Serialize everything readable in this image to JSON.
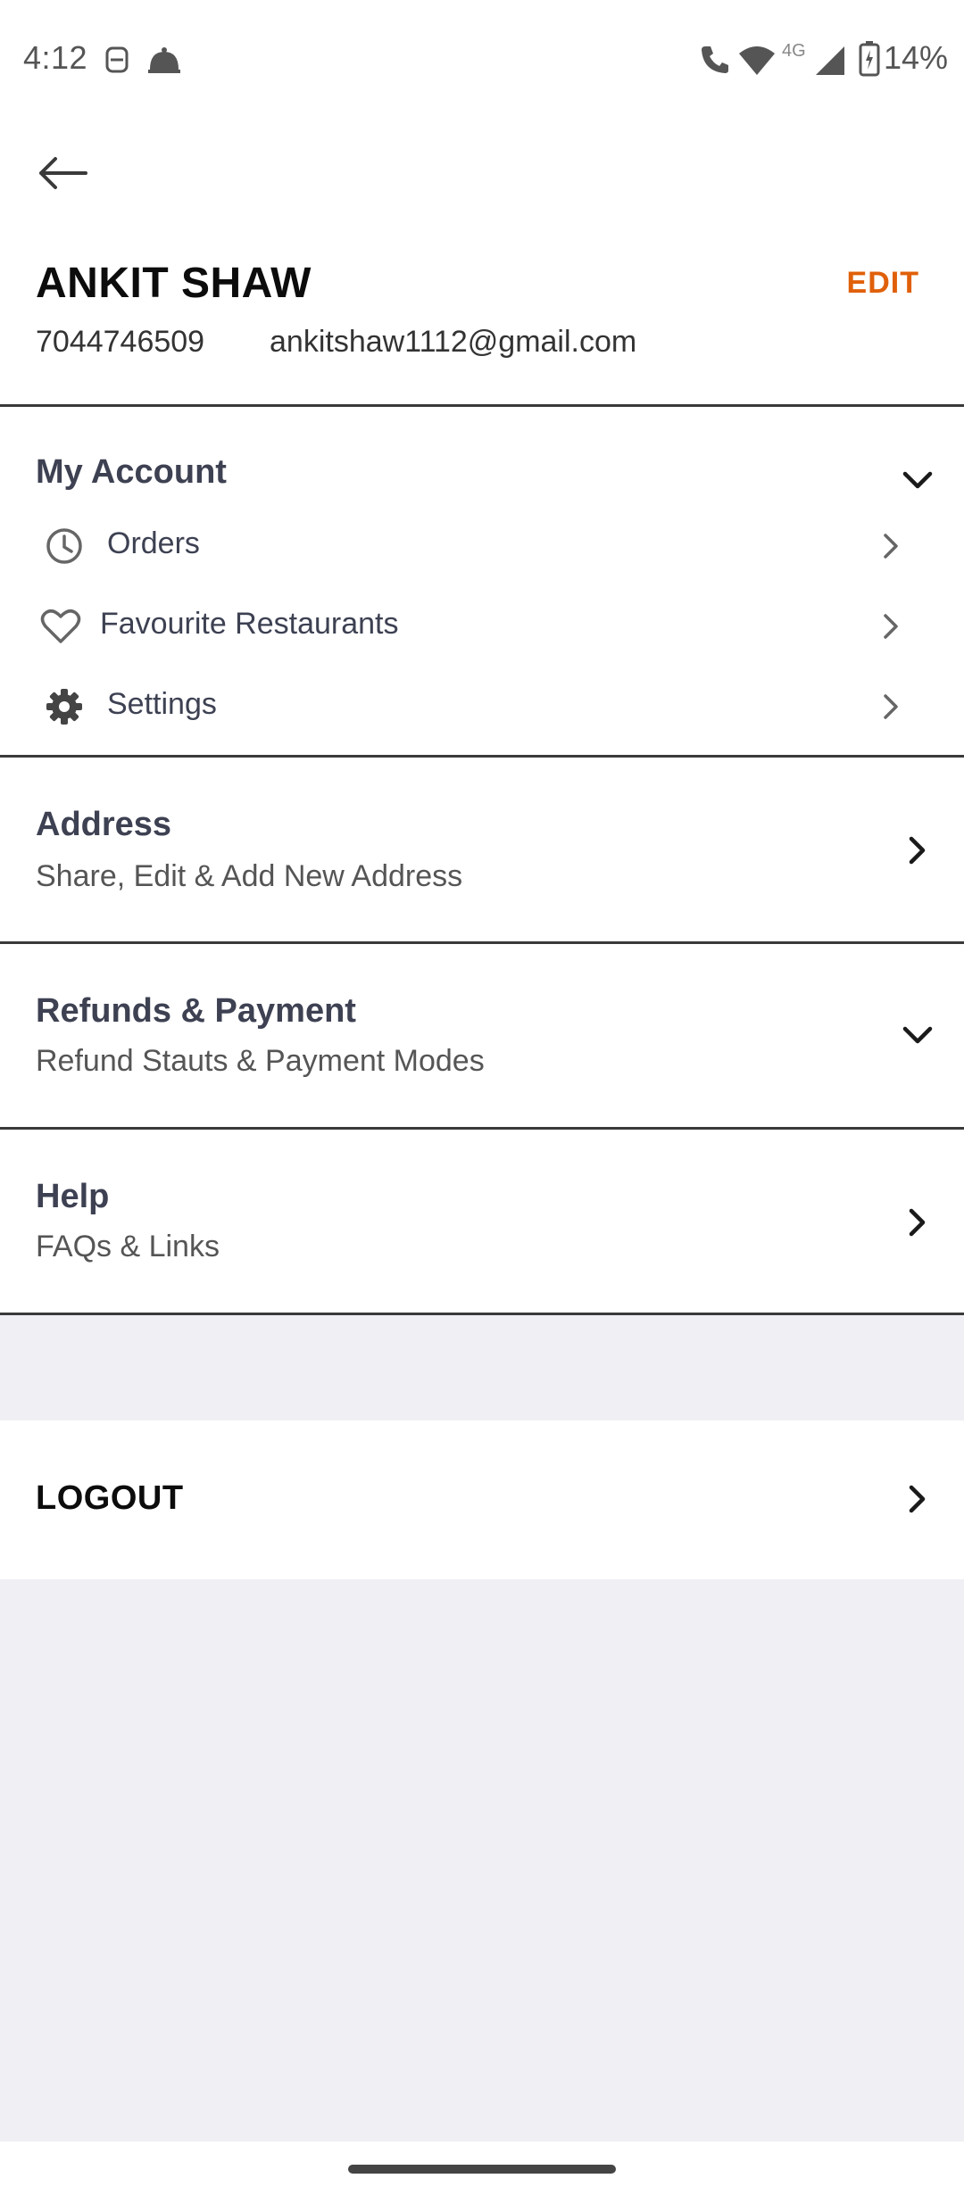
{
  "status_bar": {
    "time": "4:12",
    "network": "4G",
    "battery": "14%"
  },
  "profile": {
    "name": "ANKIT SHAW",
    "edit_label": "EDIT",
    "phone": "7044746509",
    "email": "ankitshaw1112@gmail.com"
  },
  "my_account": {
    "title": "My Account",
    "items": [
      {
        "label": "Orders",
        "icon": "clock-icon"
      },
      {
        "label": "Favourite Restaurants",
        "icon": "heart-icon"
      },
      {
        "label": "Settings",
        "icon": "gear-icon"
      }
    ]
  },
  "address": {
    "title": "Address",
    "subtitle": "Share, Edit & Add New Address"
  },
  "refunds": {
    "title": "Refunds & Payment",
    "subtitle": "Refund Stauts & Payment Modes"
  },
  "help": {
    "title": "Help",
    "subtitle": "FAQs & Links"
  },
  "logout": {
    "label": "LOGOUT"
  },
  "colors": {
    "accent": "#e0600a",
    "text": "#3d4152",
    "background": "#efeff4"
  }
}
